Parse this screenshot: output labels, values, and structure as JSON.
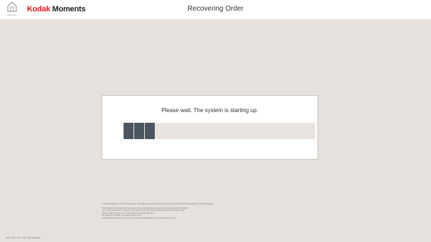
{
  "header": {
    "home_label": "Start Over",
    "brand": "Kodak",
    "brand_suffix": "Moments",
    "title": "Recovering Order"
  },
  "dialog": {
    "message": "Please wait.  The system is starting up.",
    "progress_fraction": 0.17,
    "progress_segments": 3
  },
  "legal": {
    "licensed": "Licensed Materials - © 2017 Kodak Alaris. The Kodak trademark and trade dress are used under license from Eastman Kodak Company.",
    "lines": [
      "This Software is licensed under the terms of the end user license agreement accompanying the Software.",
      "The license agreement is located on the User's Guide CD and http://www.kodakalaris.com/go/enduse",
      "Please read the agreement carefully before using the Software.",
      "By using the Software, you agree to these terms.",
      "KODAK Picture Kiosk Privacy policy is located at http://kodakmoments.kodak.com/privacy"
    ]
  },
  "build_info": "APEx: 05.01.2714 · Build: 3017 0000 0000"
}
